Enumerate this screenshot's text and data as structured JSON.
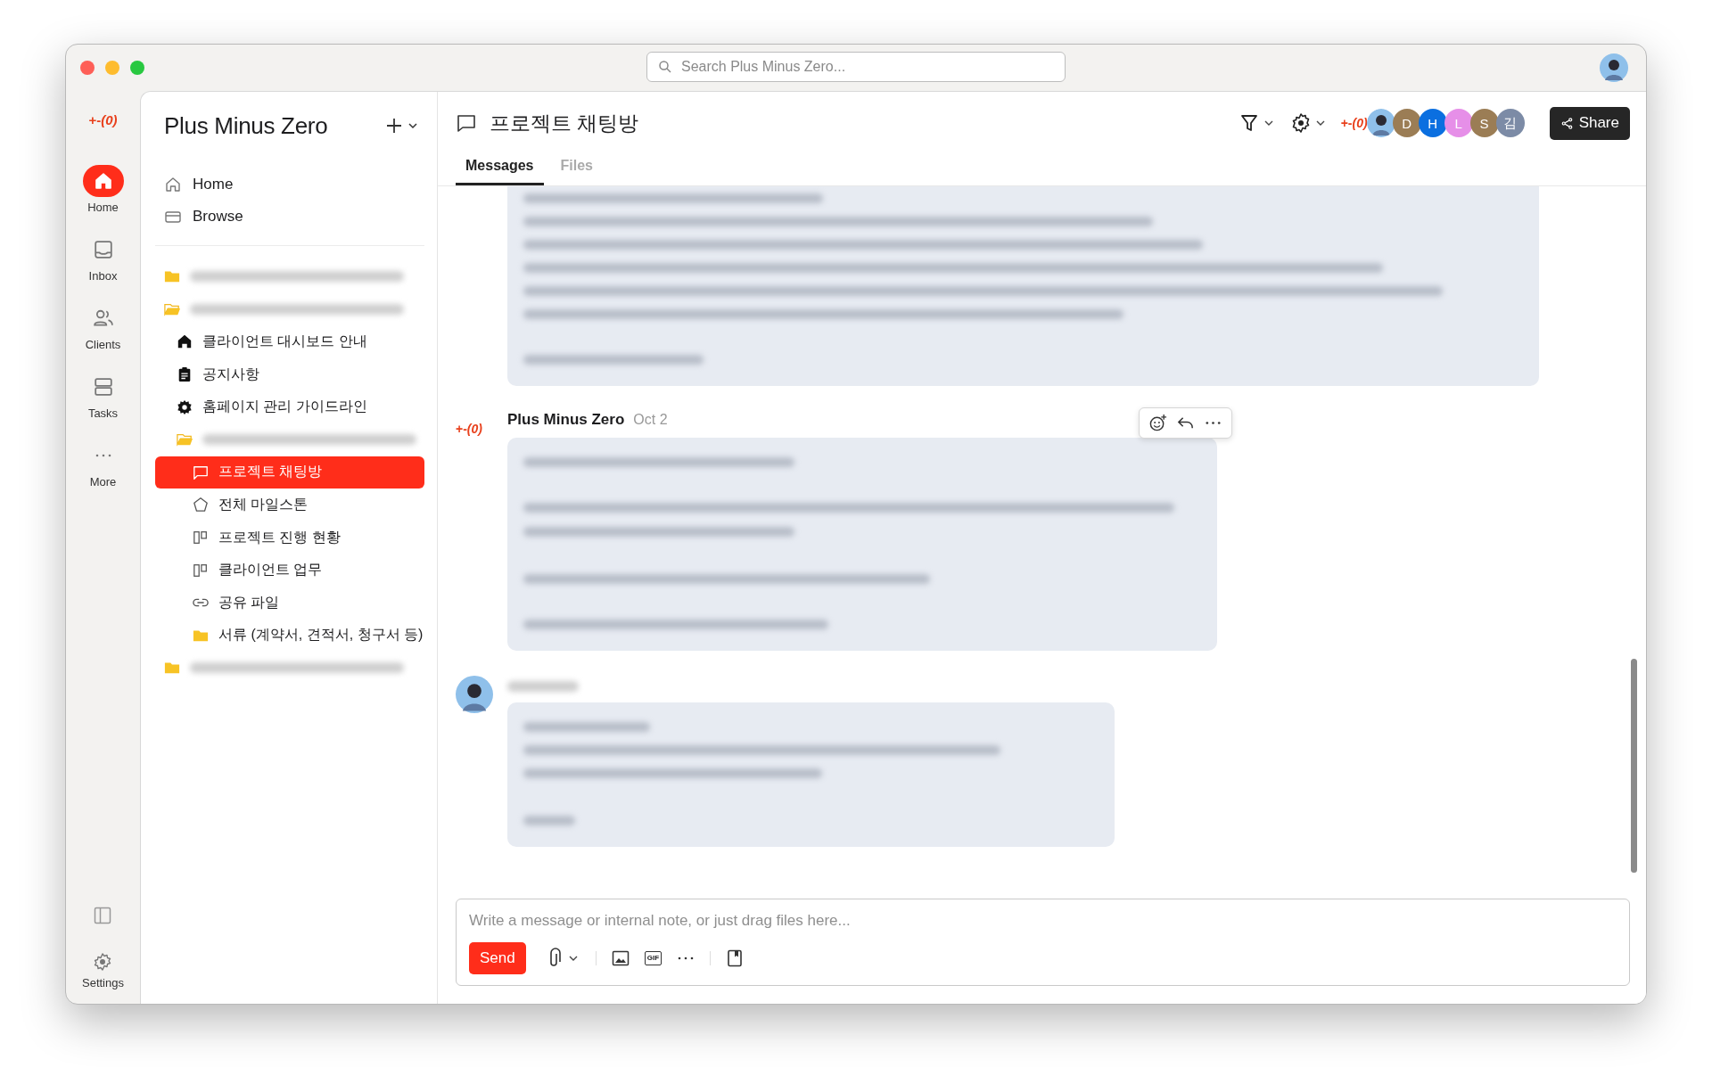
{
  "window": {
    "search_placeholder": "Search Plus Minus Zero..."
  },
  "rail": {
    "logo": "+-*(0)*",
    "items": [
      {
        "kind": "home",
        "label": "Home",
        "selected": true
      },
      {
        "kind": "inbox",
        "label": "Inbox",
        "selected": false
      },
      {
        "kind": "clients",
        "label": "Clients",
        "selected": false
      },
      {
        "kind": "tasks",
        "label": "Tasks",
        "selected": false
      },
      {
        "kind": "more",
        "label": "More",
        "selected": false
      }
    ],
    "bottom": [
      {
        "kind": "panel"
      },
      {
        "kind": "settings",
        "label": "Settings"
      }
    ]
  },
  "sidebar": {
    "title": "Plus Minus Zero",
    "nav": [
      {
        "kind": "home",
        "label": "Home"
      },
      {
        "kind": "browse",
        "label": "Browse"
      }
    ],
    "tree": [
      {
        "kind": "folder",
        "selected": false
      },
      {
        "kind": "folder-open",
        "selected": false,
        "children": [
          {
            "kind": "home",
            "label": "클라이언트 대시보드 안내",
            "selected": false
          },
          {
            "kind": "clipboard",
            "label": "공지사항",
            "selected": false
          },
          {
            "kind": "gear",
            "label": "홈페이지 관리 가이드라인",
            "selected": false
          },
          {
            "kind": "folder-open",
            "selected": false,
            "children": [
              {
                "kind": "chat",
                "label": "프로젝트 채팅방",
                "selected": true
              },
              {
                "kind": "pentagon",
                "label": "전체 마일스톤",
                "selected": false
              },
              {
                "kind": "board",
                "label": "프로젝트 진행 현황",
                "selected": false
              },
              {
                "kind": "board",
                "label": "클라이언트 업무",
                "selected": false
              },
              {
                "kind": "link",
                "label": "공유 파일",
                "selected": false
              },
              {
                "kind": "folder",
                "label": "서류 (계약서, 견적서, 청구서 등)",
                "selected": false
              }
            ]
          }
        ]
      },
      {
        "kind": "folder",
        "selected": false
      }
    ]
  },
  "channel": {
    "title": "프로젝트 채팅방",
    "tabs": [
      {
        "label": "Messages",
        "selected": true
      },
      {
        "label": "Files",
        "selected": false
      }
    ],
    "logo": "+-*(0)*",
    "members": [
      {
        "kind": "photo"
      },
      {
        "kind": "initial",
        "initial": "D",
        "color": "#9b7d55"
      },
      {
        "kind": "initial",
        "initial": "H",
        "color": "#0b6fe0"
      },
      {
        "kind": "initial",
        "initial": "L",
        "color": "#e68fe8"
      },
      {
        "kind": "initial",
        "initial": "S",
        "color": "#9b7d55"
      },
      {
        "kind": "initial",
        "initial": "김",
        "color": "#7c8ba6"
      }
    ],
    "share": "Share"
  },
  "messages": [
    {
      "kind": "continued",
      "hovered": false
    },
    {
      "kind": "brand",
      "logo": "+-*(0)*",
      "author": "Plus Minus Zero",
      "time": "Oct 2",
      "hovered": true
    },
    {
      "kind": "user",
      "hovered": false
    }
  ],
  "composer": {
    "placeholder": "Write a message or internal note, or just drag files here...",
    "send": "Send",
    "gif": "GIF"
  }
}
